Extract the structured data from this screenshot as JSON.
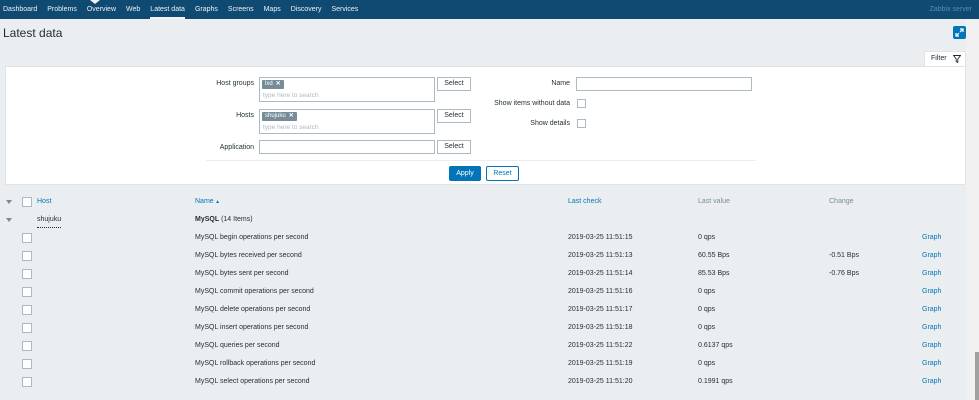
{
  "nav": {
    "items": [
      "Dashboard",
      "Problems",
      "Overview",
      "Web",
      "Latest data",
      "Graphs",
      "Screens",
      "Maps",
      "Discovery",
      "Services"
    ],
    "active_index": 4,
    "server": "Zabbix server"
  },
  "page": {
    "title": "Latest data"
  },
  "filter": {
    "tab_label": "Filter",
    "host_groups_label": "Host groups",
    "host_groups_chip": "lxd",
    "host_groups_placeholder": "type here to search",
    "hosts_label": "Hosts",
    "hosts_chip": "shujuku",
    "hosts_placeholder": "type here to search",
    "application_label": "Application",
    "application_value": "",
    "select_label": "Select",
    "name_label": "Name",
    "name_value": "",
    "show_items_without_data_label": "Show items without data",
    "show_details_label": "Show details",
    "apply_label": "Apply",
    "reset_label": "Reset"
  },
  "table": {
    "headers": {
      "host": "Host",
      "name": "Name",
      "last_check": "Last check",
      "last_value": "Last value",
      "change": "Change"
    },
    "group": {
      "host": "shujuku",
      "app": "MySQL",
      "count": "(14 Items)"
    },
    "rows": [
      {
        "name": "MySQL begin operations per second",
        "last_check": "2019-03-25 11:51:15",
        "last_value": "0 qps",
        "change": "",
        "graph": "Graph"
      },
      {
        "name": "MySQL bytes received per second",
        "last_check": "2019-03-25 11:51:13",
        "last_value": "60.55 Bps",
        "change": "-0.51 Bps",
        "graph": "Graph"
      },
      {
        "name": "MySQL bytes sent per second",
        "last_check": "2019-03-25 11:51:14",
        "last_value": "85.53 Bps",
        "change": "-0.76 Bps",
        "graph": "Graph"
      },
      {
        "name": "MySQL commit operations per second",
        "last_check": "2019-03-25 11:51:16",
        "last_value": "0 qps",
        "change": "",
        "graph": "Graph"
      },
      {
        "name": "MySQL delete operations per second",
        "last_check": "2019-03-25 11:51:17",
        "last_value": "0 qps",
        "change": "",
        "graph": "Graph"
      },
      {
        "name": "MySQL insert operations per second",
        "last_check": "2019-03-25 11:51:18",
        "last_value": "0 qps",
        "change": "",
        "graph": "Graph"
      },
      {
        "name": "MySQL queries per second",
        "last_check": "2019-03-25 11:51:22",
        "last_value": "0.6137 qps",
        "change": "",
        "graph": "Graph"
      },
      {
        "name": "MySQL rollback operations per second",
        "last_check": "2019-03-25 11:51:19",
        "last_value": "0 qps",
        "change": "",
        "graph": "Graph"
      },
      {
        "name": "MySQL select operations per second",
        "last_check": "2019-03-25 11:51:20",
        "last_value": "0.1991 qps",
        "change": "",
        "graph": "Graph"
      }
    ]
  }
}
